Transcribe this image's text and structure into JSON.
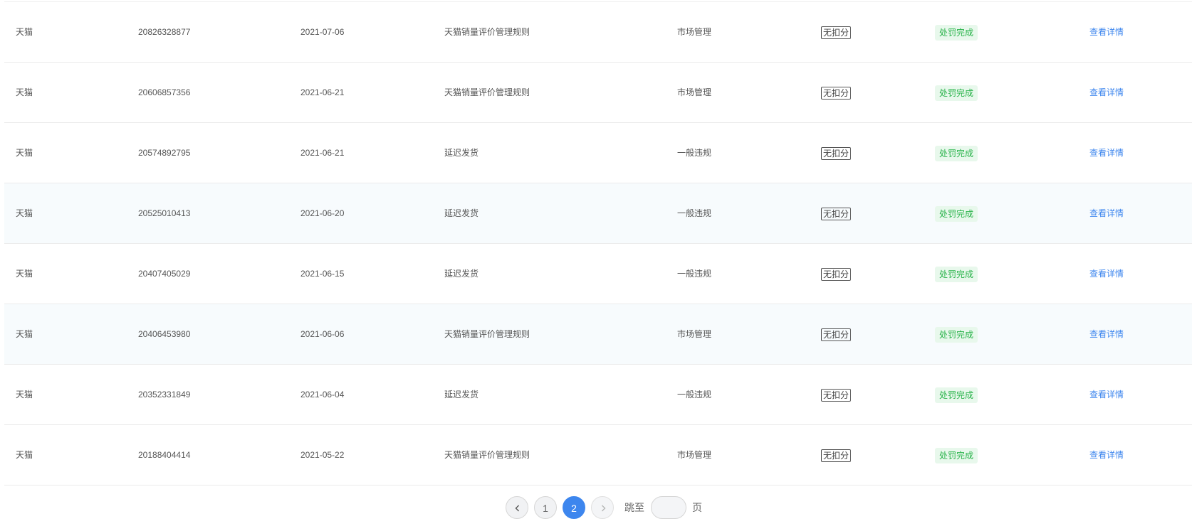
{
  "table": {
    "rows": [
      {
        "platform": "天猫",
        "id": "20826328877",
        "date": "2021-07-06",
        "rule": "天猫销量评价管理规则",
        "type": "市场管理",
        "score": "无扣分",
        "status": "处罚完成",
        "action": "查看详情"
      },
      {
        "platform": "天猫",
        "id": "20606857356",
        "date": "2021-06-21",
        "rule": "天猫销量评价管理规则",
        "type": "市场管理",
        "score": "无扣分",
        "status": "处罚完成",
        "action": "查看详情"
      },
      {
        "platform": "天猫",
        "id": "20574892795",
        "date": "2021-06-21",
        "rule": "延迟发货",
        "type": "一般违规",
        "score": "无扣分",
        "status": "处罚完成",
        "action": "查看详情"
      },
      {
        "platform": "天猫",
        "id": "20525010413",
        "date": "2021-06-20",
        "rule": "延迟发货",
        "type": "一般违规",
        "score": "无扣分",
        "status": "处罚完成",
        "action": "查看详情"
      },
      {
        "platform": "天猫",
        "id": "20407405029",
        "date": "2021-06-15",
        "rule": "延迟发货",
        "type": "一般违规",
        "score": "无扣分",
        "status": "处罚完成",
        "action": "查看详情"
      },
      {
        "platform": "天猫",
        "id": "20406453980",
        "date": "2021-06-06",
        "rule": "天猫销量评价管理规则",
        "type": "市场管理",
        "score": "无扣分",
        "status": "处罚完成",
        "action": "查看详情"
      },
      {
        "platform": "天猫",
        "id": "20352331849",
        "date": "2021-06-04",
        "rule": "延迟发货",
        "type": "一般违规",
        "score": "无扣分",
        "status": "处罚完成",
        "action": "查看详情"
      },
      {
        "platform": "天猫",
        "id": "20188404414",
        "date": "2021-05-22",
        "rule": "天猫销量评价管理规则",
        "type": "市场管理",
        "score": "无扣分",
        "status": "处罚完成",
        "action": "查看详情"
      }
    ]
  },
  "pagination": {
    "prev_icon": "chevron-left-icon",
    "next_icon": "chevron-right-icon",
    "pages": [
      "1",
      "2"
    ],
    "current_page": "2",
    "jump_label": "跳至",
    "jump_value": "",
    "page_suffix": "页"
  },
  "colors": {
    "link": "#3d86ee",
    "status_text": "#29b34a",
    "status_bg": "#e8f8ec",
    "active_page": "#3d86ee",
    "row_highlight": "#f7fbfd"
  }
}
